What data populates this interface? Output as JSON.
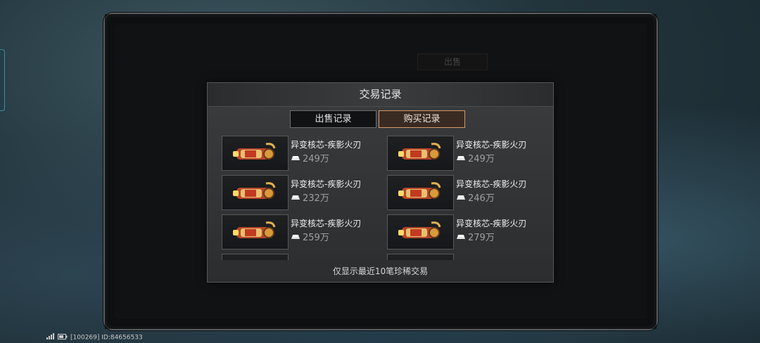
{
  "dialog": {
    "title": "交易记录",
    "tabs": [
      {
        "label": "出售记录",
        "active": false
      },
      {
        "label": "购买记录",
        "active": true
      }
    ],
    "records": [
      {
        "name": "异变核芯-疾影火刃",
        "price": "249万"
      },
      {
        "name": "异变核芯-疾影火刃",
        "price": "249万"
      },
      {
        "name": "异变核芯-疾影火刃",
        "price": "232万"
      },
      {
        "name": "异变核芯-疾影火刃",
        "price": "246万"
      },
      {
        "name": "异变核芯-疾影火刃",
        "price": "259万"
      },
      {
        "name": "异变核芯-疾影火刃",
        "price": "279万"
      }
    ],
    "footer": "仅显示最近10笔珍稀交易",
    "price_icon": "gold-bar-icon"
  },
  "background": {
    "active_tab": "出售"
  },
  "status_bar": {
    "text": "[100269] ID:84656533"
  },
  "colors": {
    "accent": "#d29a6c",
    "panel_bg": "#2b2d2f"
  }
}
